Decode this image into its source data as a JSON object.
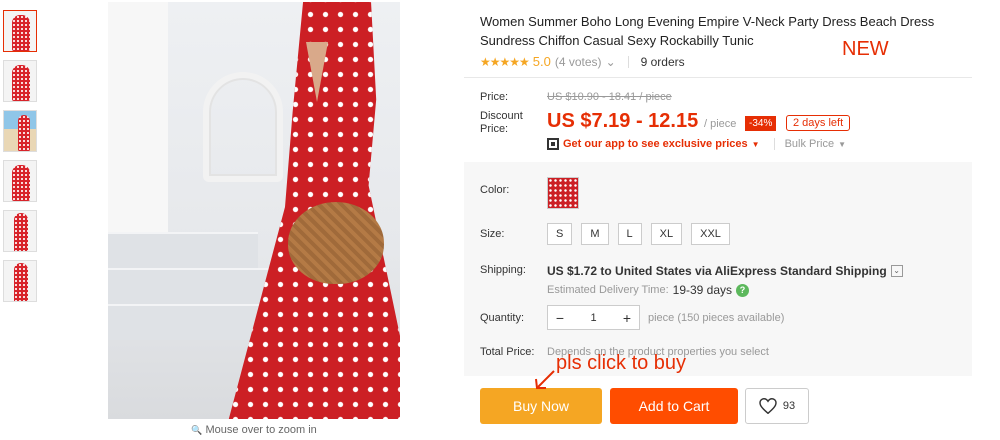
{
  "product": {
    "title": "Women Summer Boho Long Evening Empire V-Neck Party Dress Beach Dress Sundress Chiffon Casual Sexy Rockabilly Tunic",
    "new_tag": "NEW"
  },
  "rating": {
    "stars": "★★★★★",
    "score": "5.0",
    "votes": "(4 votes)",
    "votes_chevron": "⌄",
    "orders": "9 orders"
  },
  "price": {
    "label": "Price:",
    "original": "US $10.90 - 18.41 / piece",
    "discount_label": "Discount Price:",
    "discounted": "US $7.19 - 12.15",
    "unit": "/ piece",
    "discount_badge": "-34%",
    "days_left": "2 days left",
    "app_text": "Get our app to see exclusive prices",
    "app_chevron": "▼",
    "bulk": "Bulk Price",
    "bulk_chevron": "▼"
  },
  "options": {
    "color_label": "Color:",
    "size_label": "Size:",
    "sizes": [
      "S",
      "M",
      "L",
      "XL",
      "XXL"
    ],
    "shipping_label": "Shipping:",
    "shipping_text": "US $1.72 to United States via AliExpress Standard Shipping",
    "shipping_chevron": "⌄",
    "est_label": "Estimated Delivery Time:",
    "est_days": "19-39 days",
    "help": "?",
    "quantity_label": "Quantity:",
    "qty_minus": "−",
    "qty_value": "1",
    "qty_plus": "+",
    "qty_note": "piece (150 pieces available)",
    "total_label": "Total Price:",
    "total_note": "Depends on the product properties you select"
  },
  "actions": {
    "buy_now": "Buy Now",
    "add_to_cart": "Add to Cart",
    "wishlist_count": "93"
  },
  "gallery": {
    "zoom_hint": "Mouse over to zoom in",
    "zoom_icon": "🔍"
  },
  "annotation": "pls click to buy",
  "colors": {
    "accent": "#e62e04",
    "buy_now": "#f5a623",
    "add_to_cart": "#ff4d00",
    "dress_red": "#cc1f24"
  }
}
